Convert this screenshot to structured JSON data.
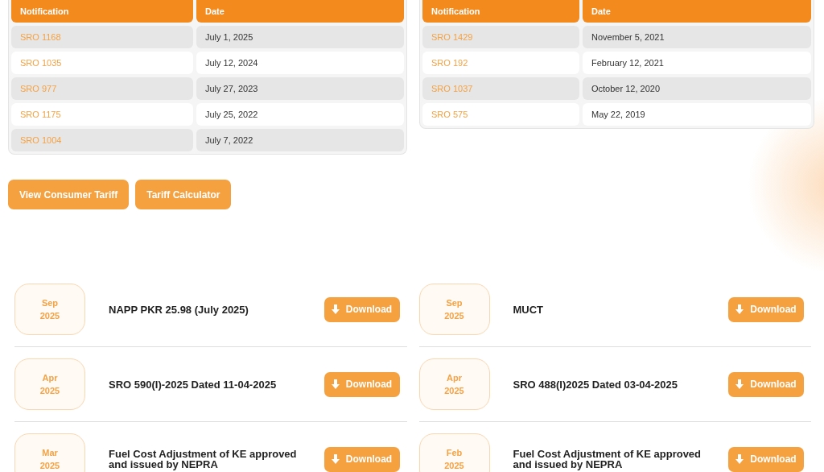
{
  "tables": [
    {
      "columns": [
        "Notification",
        "Date"
      ],
      "rows": [
        {
          "notification": "SRO 1168",
          "date": "July 1, 2025"
        },
        {
          "notification": "SRO 1035",
          "date": "July 12, 2024"
        },
        {
          "notification": "SRO 977",
          "date": "July 27, 2023"
        },
        {
          "notification": "SRO 1175",
          "date": "July 25, 2022"
        },
        {
          "notification": "SRO 1004",
          "date": "July 7, 2022"
        }
      ]
    },
    {
      "columns": [
        "Notification",
        "Date"
      ],
      "rows": [
        {
          "notification": "SRO 1429",
          "date": "November 5, 2021"
        },
        {
          "notification": "SRO 192",
          "date": "February 12, 2021"
        },
        {
          "notification": "SRO 1037",
          "date": "October 12, 2020"
        },
        {
          "notification": "SRO 575",
          "date": "May 22, 2019"
        }
      ]
    }
  ],
  "buttons": [
    "View Consumer Tariff",
    "Tariff Calculator"
  ],
  "documents": [
    [
      {
        "month": "Sep",
        "year": "2025",
        "title": "NAPP PKR 25.98 (July 2025)",
        "action": "Download"
      },
      {
        "month": "Apr",
        "year": "2025",
        "title": "SRO 590(I)-2025 Dated 11-04-2025",
        "action": "Download"
      },
      {
        "month": "Mar",
        "year": "2025",
        "title": "Fuel Cost Adjustment of KE approved and issued by NEPRA",
        "action": "Download"
      }
    ],
    [
      {
        "month": "Sep",
        "year": "2025",
        "title": "MUCT",
        "action": "Download"
      },
      {
        "month": "Apr",
        "year": "2025",
        "title": "SRO 488(I)2025 Dated 03-04-2025",
        "action": "Download"
      },
      {
        "month": "Feb",
        "year": "2025",
        "title": "Fuel Cost Adjustment of KE approved and issued by NEPRA",
        "action": "Download"
      }
    ]
  ]
}
